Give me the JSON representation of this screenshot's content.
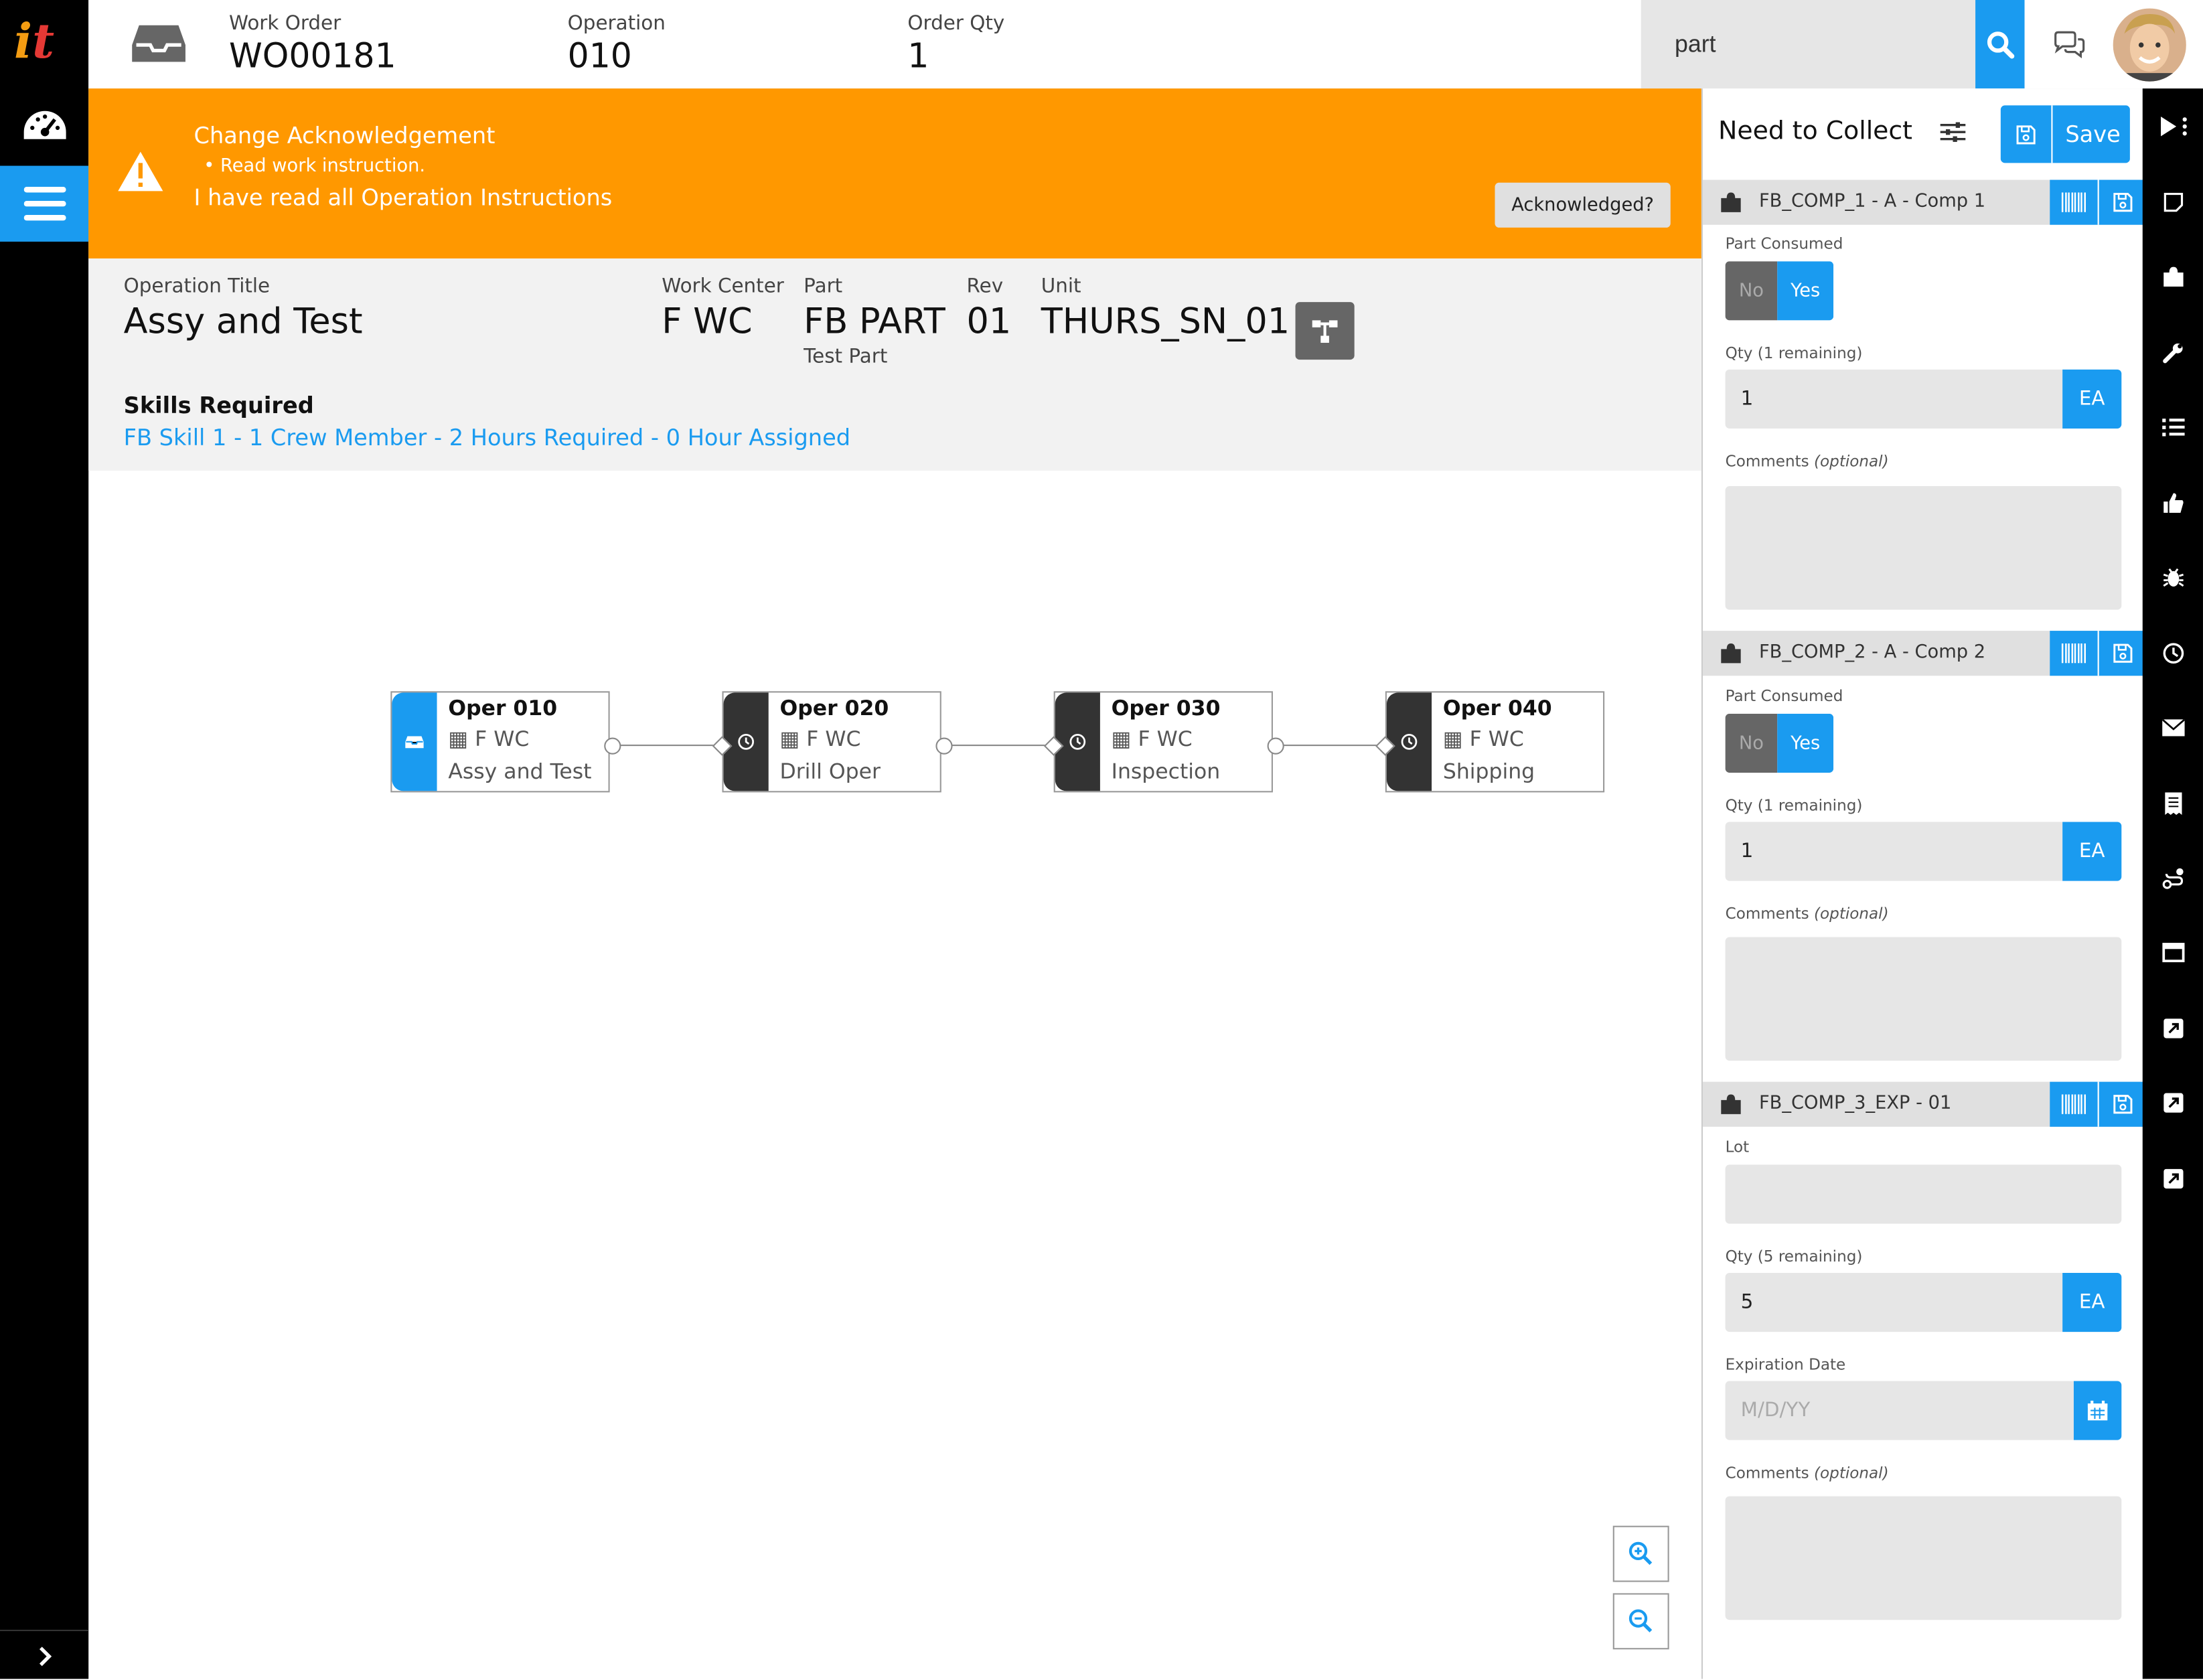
{
  "header": {
    "work_order_label": "Work Order",
    "work_order": "WO00181",
    "operation_label": "Operation",
    "operation": "010",
    "order_qty_label": "Order Qty",
    "order_qty": "1",
    "search_value": "part",
    "icons": [
      "inbox-icon",
      "search-icon",
      "chat-icon",
      "avatar"
    ]
  },
  "nav": {
    "logo_i": "i",
    "logo_t": "t",
    "icons": [
      "dashboard-icon",
      "menu-icon",
      "chevron-right-icon"
    ]
  },
  "alert": {
    "title": "Change Acknowledgement",
    "bullet": "Read work instruction.",
    "text": "I have read all Operation Instructions",
    "button": "Acknowledged?"
  },
  "info": {
    "op_title_label": "Operation Title",
    "op_title": "Assy and Test",
    "work_center_label": "Work Center",
    "work_center": "F WC",
    "part_label": "Part",
    "part": "FB PART",
    "part_desc": "Test Part",
    "rev_label": "Rev",
    "rev": "01",
    "unit_label": "Unit",
    "unit": "THURS_SN_01",
    "skills_label": "Skills Required",
    "skills": "FB Skill 1 - 1 Crew Member - 2 Hours Required - 0 Hour Assigned"
  },
  "flow": {
    "operations": [
      {
        "name": "Oper 010",
        "wc": "F WC",
        "title": "Assy and Test",
        "active": true
      },
      {
        "name": "Oper 020",
        "wc": "F WC",
        "title": "Drill Oper",
        "active": false
      },
      {
        "name": "Oper 030",
        "wc": "F WC",
        "title": "Inspection",
        "active": false
      },
      {
        "name": "Oper 040",
        "wc": "F WC",
        "title": "Shipping",
        "active": false
      }
    ]
  },
  "panel": {
    "title": "Need to Collect",
    "save": "Save",
    "components": [
      {
        "name": "FB_COMP_1 - A - Comp 1",
        "part_consumed_label": "Part Consumed",
        "no": "No",
        "yes": "Yes",
        "qty_label": "Qty (1 remaining)",
        "qty": "1",
        "unit": "EA",
        "comments_label": "Comments",
        "optional": "(optional)"
      },
      {
        "name": "FB_COMP_2 - A - Comp 2",
        "part_consumed_label": "Part Consumed",
        "no": "No",
        "yes": "Yes",
        "qty_label": "Qty (1 remaining)",
        "qty": "1",
        "unit": "EA",
        "comments_label": "Comments",
        "optional": "(optional)"
      },
      {
        "name": "FB_COMP_3_EXP - 01",
        "lot_label": "Lot",
        "qty_label": "Qty (5 remaining)",
        "qty": "5",
        "unit": "EA",
        "exp_label": "Expiration Date",
        "exp_placeholder": "M/D/YY",
        "comments_label": "Comments",
        "optional": "(optional)"
      }
    ]
  },
  "toolbar_icons": [
    "play-icon",
    "note-icon",
    "puzzle-icon",
    "wrench-icon",
    "list-icon",
    "thumbs-up-icon",
    "bug-icon",
    "clock-icon",
    "mail-icon",
    "receipt-icon",
    "route-icon",
    "window-icon",
    "external-link-icon",
    "external-link-icon",
    "external-link-icon"
  ],
  "colors": {
    "accent": "#1a9bf0",
    "alert": "#ff9800",
    "dark": "#000000"
  }
}
